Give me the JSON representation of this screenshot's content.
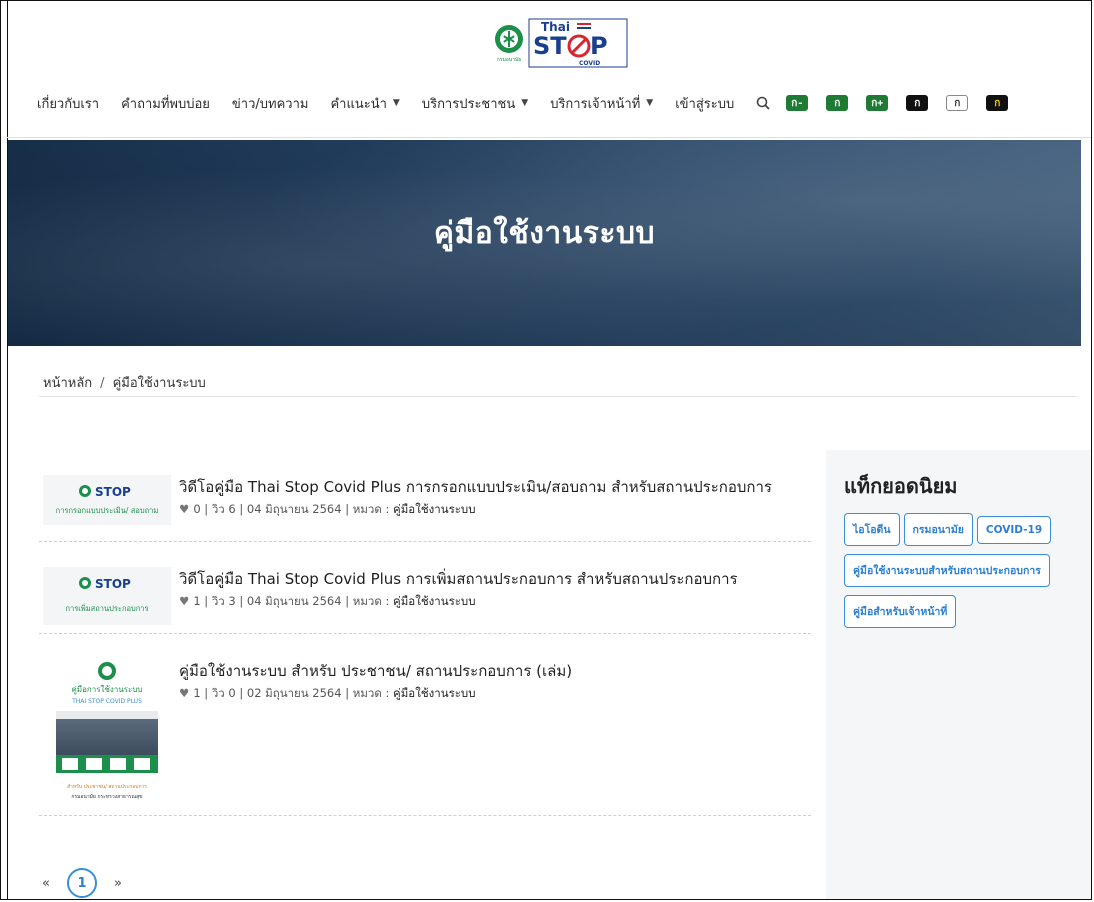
{
  "logo": {
    "brand_top": "Thai",
    "brand_main": "STOP",
    "brand_sub": "COVID",
    "department": "กรมอนามัย"
  },
  "nav": {
    "items": [
      {
        "label": "เกี่ยวกับเรา",
        "dropdown": false
      },
      {
        "label": "คำถามที่พบบ่อย",
        "dropdown": false
      },
      {
        "label": "ข่าว/บทความ",
        "dropdown": false
      },
      {
        "label": "คำแนะนำ",
        "dropdown": true
      },
      {
        "label": "บริการประชาชน",
        "dropdown": true
      },
      {
        "label": "บริการเจ้าหน้าที่",
        "dropdown": true
      },
      {
        "label": "เข้าสู่ระบบ",
        "dropdown": false
      }
    ],
    "search_icon": "search-icon",
    "font_size_buttons": [
      "ก-",
      "ก",
      "ก+"
    ],
    "contrast_buttons": [
      "ก",
      "ก",
      "ก"
    ]
  },
  "banner": {
    "title": "คู่มือใช้งานระบบ"
  },
  "breadcrumb": {
    "home": "หน้าหลัก",
    "separator": "/",
    "current": "คู่มือใช้งานระบบ"
  },
  "posts": [
    {
      "title": "วิดีโอคู่มือ Thai Stop Covid Plus การกรอกแบบประเมิน/สอบถาม สำหรับสถานประกอบการ",
      "stats": "0 | วิว 6 | 04 มิถุนายน 2564 | หมวด : ",
      "category": "คู่มือใช้งานระบบ",
      "thumb_caption": "การกรอกแบบประเมิน/ สอบถาม"
    },
    {
      "title": "วิดีโอคู่มือ Thai Stop Covid Plus การเพิ่มสถานประกอบการ สำหรับสถานประกอบการ",
      "stats": "1 | วิว 3 | 04 มิถุนายน 2564 | หมวด : ",
      "category": "คู่มือใช้งานระบบ",
      "thumb_caption": "การเพิ่มสถานประกอบการ"
    },
    {
      "title": "คู่มือใช้งานระบบ สำหรับ ประชาชน/ สถานประกอบการ (เล่ม)",
      "stats": "1 | วิว 0 | 02 มิถุนายน 2564 | หมวด : ",
      "category": "คู่มือใช้งานระบบ",
      "thumb_title": "คู่มือการใช้งานระบบ",
      "thumb_subtitle": "THAI STOP COVID PLUS",
      "thumb_footer_1": "สำหรับ ประชาชน/ สถานประกอบการ",
      "thumb_footer_2": "กรมอนามัย กระทรวงสาธารณสุข"
    }
  ],
  "sidebar": {
    "heading": "แท็กยอดนิยม",
    "tags": [
      "ไอโอดีน",
      "กรมอนามัย",
      "COVID-19",
      "คู่มือใช้งานระบบสำหรับสถานประกอบการ",
      "คู่มือสำหรับเจ้าหน้าที่"
    ]
  },
  "pagination": {
    "prev": "«",
    "current": "1",
    "next": "»"
  },
  "colors": {
    "accent": "#3a8ed8",
    "brand_green": "#1c8f4a",
    "brand_red": "#d62631",
    "brand_blue": "#1a3f8f",
    "banner": "#2a4a6d"
  }
}
